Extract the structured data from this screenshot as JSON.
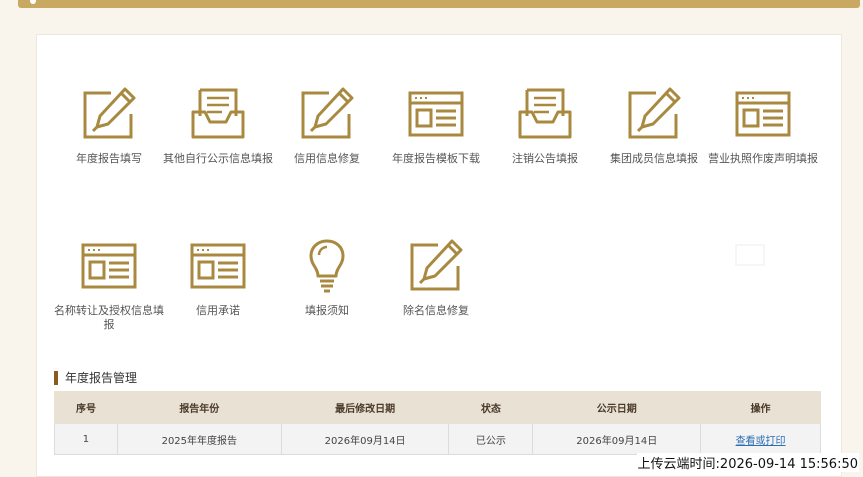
{
  "theme": {
    "accent": "#a8893f",
    "header_bar": "#c9a862",
    "link": "#2a6fb5"
  },
  "tiles_row1": [
    {
      "label": "年度报告填写",
      "icon": "edit-icon"
    },
    {
      "label": "其他自行公示信息填报",
      "icon": "inbox-icon"
    },
    {
      "label": "信用信息修复",
      "icon": "edit-icon"
    },
    {
      "label": "年度报告模板下载",
      "icon": "window-icon"
    },
    {
      "label": "注销公告填报",
      "icon": "inbox-icon"
    },
    {
      "label": "集团成员信息填报",
      "icon": "edit-icon"
    },
    {
      "label": "营业执照作废声明填报",
      "icon": "window-icon"
    }
  ],
  "tiles_row2": [
    {
      "label": "名称转让及授权信息填报",
      "icon": "window-icon"
    },
    {
      "label": "信用承诺",
      "icon": "window-icon"
    },
    {
      "label": "填报须知",
      "icon": "lightbulb-icon"
    },
    {
      "label": "除名信息修复",
      "icon": "edit-icon"
    }
  ],
  "section": {
    "title": "年度报告管理"
  },
  "table": {
    "headers": [
      "序号",
      "报告年份",
      "最后修改日期",
      "状态",
      "公示日期",
      "操作"
    ],
    "rows": [
      {
        "index": "1",
        "year": "2025年年度报告",
        "modified": "2026年09月14日",
        "status": "已公示",
        "published": "2026年09月14日",
        "action": "查看或打印"
      }
    ]
  },
  "footer": {
    "timestamp": "上传云端时间:2026-09-14 15:56:50"
  }
}
